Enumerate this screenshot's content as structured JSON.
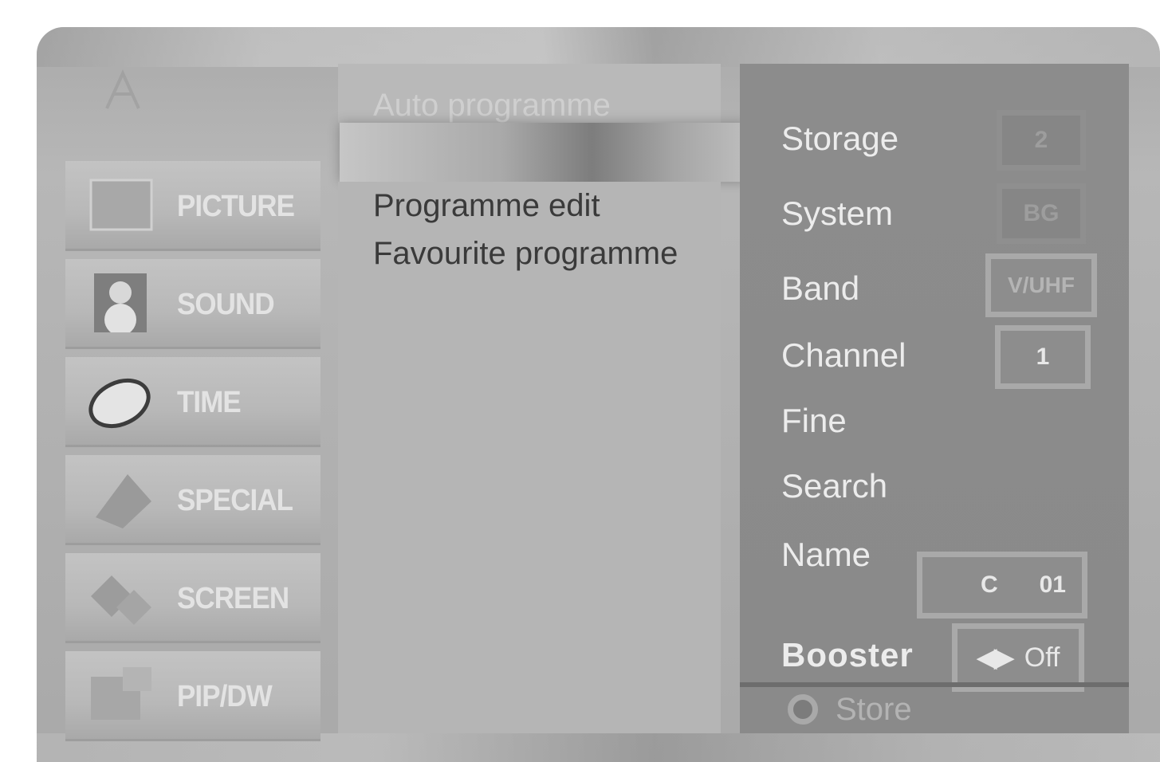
{
  "sidebar": {
    "items": [
      {
        "label": "PICTURE",
        "icon": "picture-icon"
      },
      {
        "label": "SOUND",
        "icon": "sound-icon"
      },
      {
        "label": "TIME",
        "icon": "time-icon"
      },
      {
        "label": "SPECIAL",
        "icon": "special-icon"
      },
      {
        "label": "SCREEN",
        "icon": "screen-icon"
      },
      {
        "label": "PIP/DW",
        "icon": "pip-icon"
      }
    ]
  },
  "menu": {
    "auto_programme": "Auto programme",
    "programme_edit": "Programme edit",
    "favourite_programme": "Favourite programme"
  },
  "settings": {
    "storage": {
      "label": "Storage",
      "value": "2"
    },
    "system": {
      "label": "System",
      "value": "BG"
    },
    "band": {
      "label": "Band",
      "value": "V/UHF"
    },
    "channel": {
      "label": "Channel",
      "value": "1"
    },
    "fine": {
      "label": "Fine"
    },
    "search": {
      "label": "Search"
    },
    "name": {
      "label": "Name",
      "value_prefix": "C",
      "value_number": "01"
    },
    "booster": {
      "label": "Booster",
      "arrows": "◀▶",
      "value": "Off"
    }
  },
  "footer": {
    "store_label": "Store"
  }
}
